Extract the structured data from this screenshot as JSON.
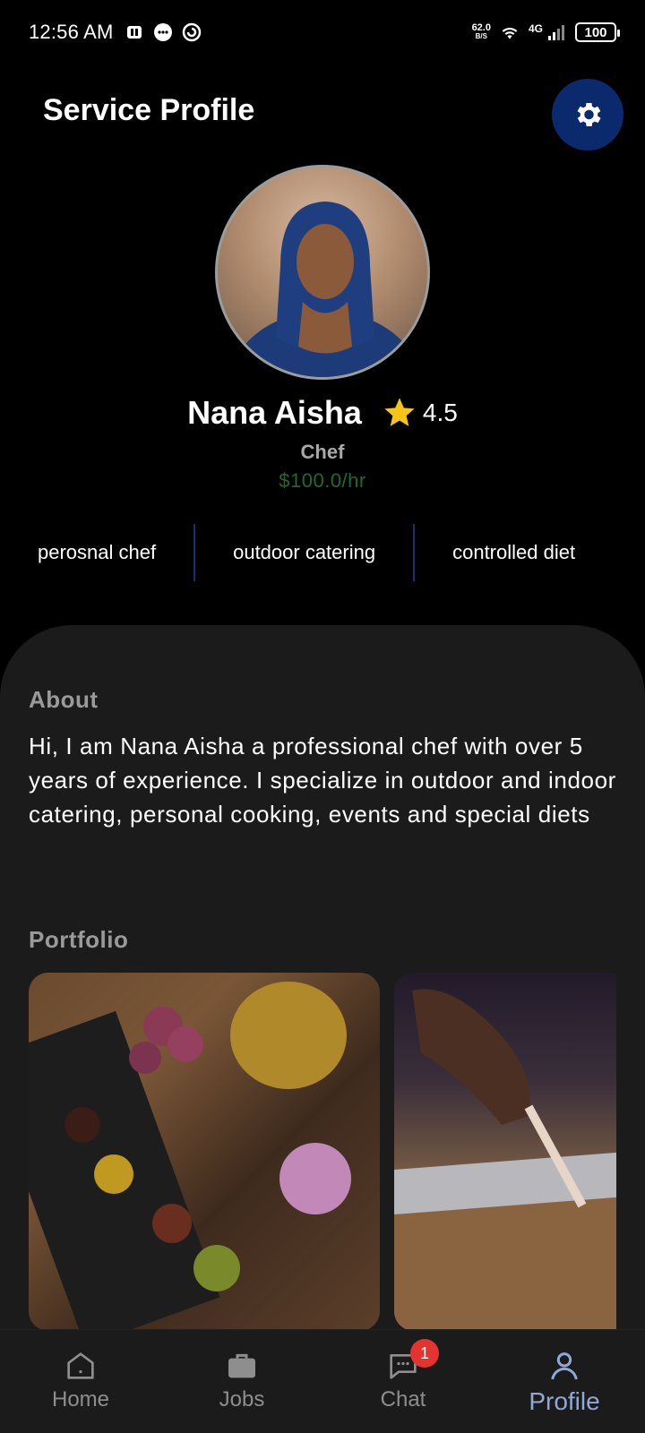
{
  "status_bar": {
    "time": "12:56 AM",
    "net_speed_value": "62.0",
    "net_speed_unit": "B/S",
    "network_type": "4G",
    "battery": "100"
  },
  "header": {
    "title": "Service Profile",
    "settings_icon": "gear-icon"
  },
  "profile": {
    "name": "Nana Aisha",
    "rating": "4.5",
    "role": "Chef",
    "rate": "$100.0/hr",
    "tags": [
      "perosnal chef",
      "outdoor catering",
      "controlled diet"
    ]
  },
  "about": {
    "label": "About",
    "text": "Hi, I am Nana Aisha a professional chef with over 5 years of experience. I specialize in outdoor and indoor catering, personal cooking, events and special diets"
  },
  "portfolio": {
    "label": "Portfolio"
  },
  "nav": {
    "items": [
      {
        "label": "Home",
        "icon": "home-icon"
      },
      {
        "label": "Jobs",
        "icon": "briefcase-icon"
      },
      {
        "label": "Chat",
        "icon": "chat-icon",
        "badge": "1"
      },
      {
        "label": "Profile",
        "icon": "profile-icon",
        "active": true
      }
    ]
  },
  "colors": {
    "accent": "#0b2a6e",
    "rate_green": "#1f6b2b",
    "active_nav": "#8fa8d8",
    "badge_red": "#e3342f",
    "star": "#f5c518"
  }
}
